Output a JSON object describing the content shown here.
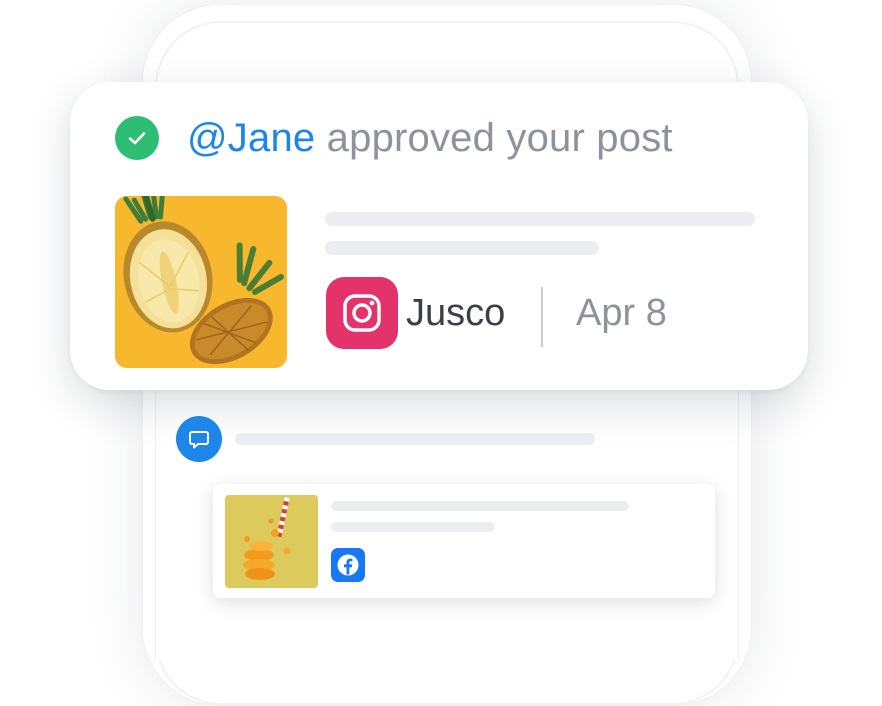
{
  "notification": {
    "mention": "@Jane",
    "action": "approved your post",
    "account": "Jusco",
    "date": "Apr 8",
    "status_icon": "check-icon",
    "platform_icon": "instagram-icon",
    "thumbnail_icon": "pineapple-image"
  },
  "feed": {
    "comment_icon": "comment-icon",
    "post_platform_icon": "facebook-icon",
    "post_thumbnail_icon": "orange-juice-image"
  },
  "colors": {
    "accent_blue": "#1d86e8",
    "success_green": "#2dbe73",
    "instagram_pink": "#e4336a",
    "facebook_blue": "#1877f2",
    "muted_text": "#8c939c",
    "skeleton": "#ebedf0"
  }
}
